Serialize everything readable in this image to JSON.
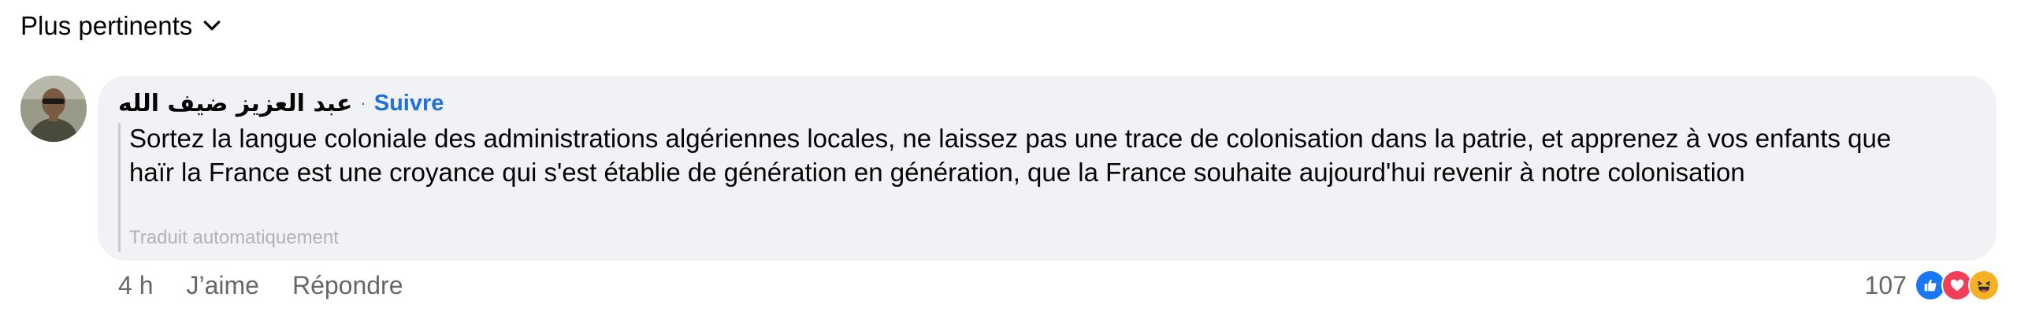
{
  "sort": {
    "label": "Plus pertinents",
    "icon": "chevron-down-icon"
  },
  "comment": {
    "author": "عبد العزيز ضيف الله",
    "separator": "·",
    "follow_label": "Suivre",
    "text": "Sortez la langue coloniale des administrations algériennes locales, ne laissez pas une trace de colonisation dans la patrie, et apprenez à vos enfants que haïr la France est une croyance qui s'est établie de génération en génération, que la France souhaite aujourd'hui revenir à notre colonisation",
    "translated_note": "Traduit automatiquement",
    "time": "4 h",
    "like_label": "J’aime",
    "reply_label": "Répondre",
    "reactions": {
      "count": "107",
      "icons": [
        "like-icon",
        "love-icon",
        "haha-icon"
      ]
    }
  },
  "colors": {
    "bubble": "#f0f2f5",
    "follow": "#216fdb",
    "like": "#1877f2",
    "love": "#f33e58",
    "haha": "#f7b125"
  }
}
